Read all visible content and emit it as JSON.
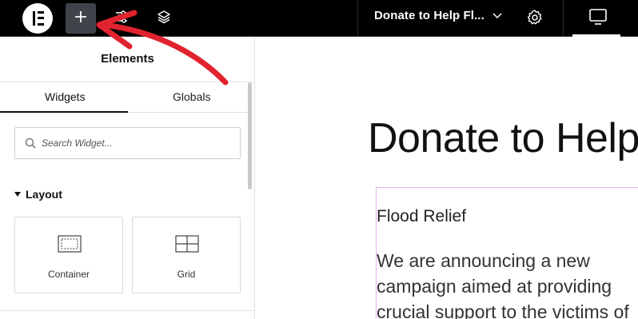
{
  "topbar": {
    "page_title": "Donate to Help Fl...",
    "add_button_glyph": "+"
  },
  "panel": {
    "title": "Elements",
    "tabs": [
      {
        "label": "Widgets",
        "active": true
      },
      {
        "label": "Globals",
        "active": false
      }
    ],
    "search": {
      "placeholder": "Search Widget..."
    },
    "section": {
      "label": "Layout",
      "expanded": true
    },
    "widgets": [
      {
        "label": "Container",
        "icon": "container-icon"
      },
      {
        "label": "Grid",
        "icon": "grid-icon"
      }
    ]
  },
  "canvas": {
    "heading": "Donate to Help",
    "subheading": "Flood Relief",
    "paragraph_lines": [
      "We are announcing a new",
      "campaign aimed at providing",
      "crucial support to the victims of"
    ]
  },
  "colors": {
    "topbar_bg": "#000000",
    "active_button_bg": "#3f444b",
    "annotation_arrow": "#e0232e",
    "selection_outline": "#e8b6ee"
  }
}
